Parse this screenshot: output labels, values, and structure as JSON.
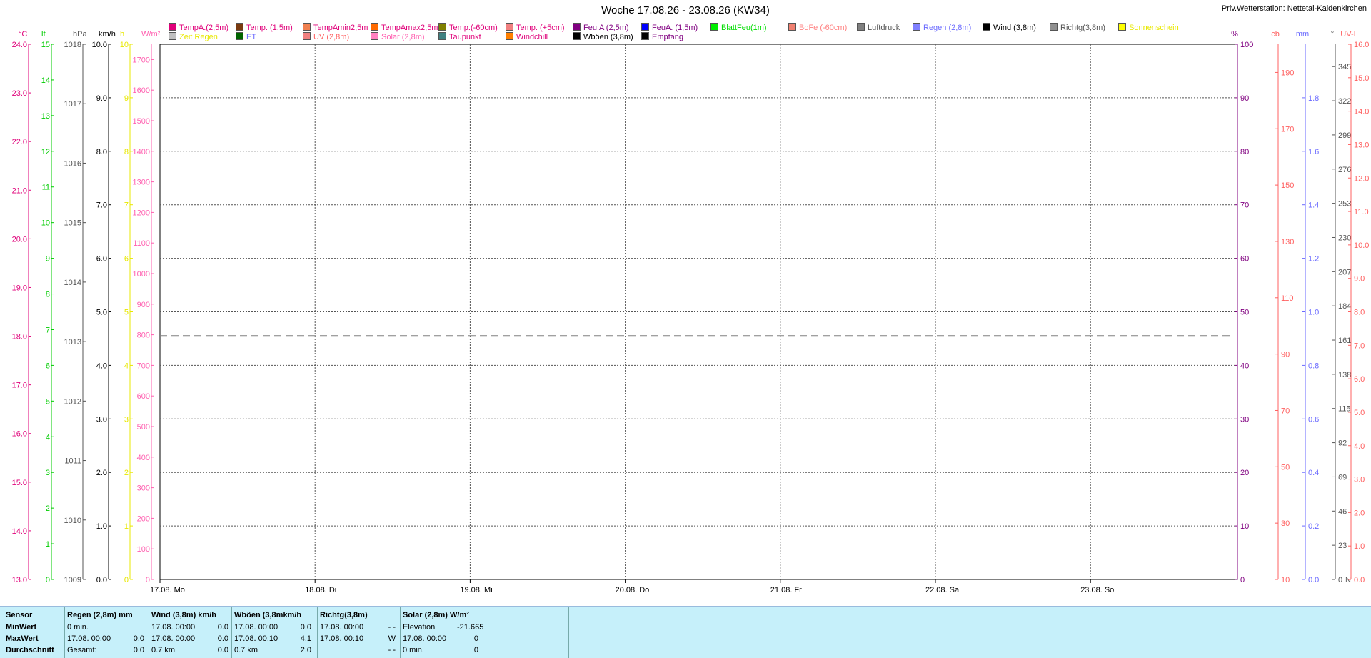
{
  "title": "Woche 17.08.26 - 23.08.26 (KW34)",
  "station": "Priv.Wetterstation: Nettetal-Kaldenkirchen",
  "legend": [
    {
      "label": "TempA.(2,5m)",
      "color": "#e0007a",
      "swatch": "#e0007a"
    },
    {
      "label": "Temp. (1,5m)",
      "color": "#e0007a",
      "swatch": "#7a3a10"
    },
    {
      "label": "TempAmin2,5m",
      "color": "#e0007a",
      "swatch": "#f08050"
    },
    {
      "label": "TempAmax2,5m",
      "color": "#e0007a",
      "swatch": "#ff6a00"
    },
    {
      "label": "Temp.(-60cm)",
      "color": "#e0007a",
      "swatch": "#808000"
    },
    {
      "label": "Temp. (+5cm)",
      "color": "#e0007a",
      "swatch": "#f08080"
    },
    {
      "label": "Feu.A (2,5m)",
      "color": "#800080",
      "swatch": "#800080"
    },
    {
      "label": "FeuA. (1,5m)",
      "color": "#800080",
      "swatch": "#0000ff"
    },
    {
      "label": "BlattFeu(1m)",
      "color": "#00dd00",
      "swatch": "#00ee00"
    },
    {
      "label": "BoFe (-60cm)",
      "color": "#ff8080",
      "swatch": "#f08070"
    },
    {
      "label": "Luftdruck",
      "color": "#555555",
      "swatch": "#808080"
    },
    {
      "label": "Regen (2,8m)",
      "color": "#6a6aff",
      "swatch": "#8080ff"
    },
    {
      "label": "Wind (3,8m)",
      "color": "#000000",
      "swatch": "#000000"
    },
    {
      "label": "Richtg(3,8m)",
      "color": "#555555",
      "swatch": "#909090"
    },
    {
      "label": "Sonnenschein",
      "color": "#e8e800",
      "swatch": "#ffff00"
    },
    {
      "label": "Zeit Regen",
      "color": "#e8e800",
      "swatch": "#c0c0c0"
    },
    {
      "label": "ET",
      "color": "#6a6aff",
      "swatch": "#006400"
    },
    {
      "label": "UV (2,8m)",
      "color": "#ff6060",
      "swatch": "#f08080"
    },
    {
      "label": "Solar (2,8m)",
      "color": "#ff60b0",
      "swatch": "#ff80c0"
    },
    {
      "label": "Taupunkt",
      "color": "#e0007a",
      "swatch": "#408080"
    },
    {
      "label": "Windchill",
      "color": "#e0007a",
      "swatch": "#ff8000"
    },
    {
      "label": "Wböen (3,8m)",
      "color": "#000000",
      "swatch": "#000000"
    },
    {
      "label": "Empfang",
      "color": "#800080",
      "swatch": "#000000"
    }
  ],
  "chart_data": {
    "type": "line",
    "x_categories": [
      "17.08.  Mo",
      "18.08.  Di",
      "19.08.  Mi",
      "20.08.  Do",
      "21.08.  Fr",
      "22.08.  Sa",
      "23.08.  So"
    ],
    "series": [
      {
        "name": "Luftdruck",
        "unit": "hPa",
        "values": [
          1013.1,
          1013.1,
          1013.1,
          1013.1,
          1013.1,
          1013.1,
          1013.1,
          1013.1
        ],
        "color": "#808080",
        "dash": true
      }
    ],
    "axes": {
      "left": [
        {
          "unit": "°C",
          "color": "#e0007a",
          "min": 13,
          "max": 24,
          "ticks": [
            "24.0",
            "23.0",
            "22.0",
            "21.0",
            "20.0",
            "19.0",
            "18.0",
            "17.0",
            "16.0",
            "15.0",
            "14.0",
            "13.0"
          ]
        },
        {
          "unit": "lf",
          "color": "#00cc00",
          "min": 0,
          "max": 15,
          "ticks": [
            "15",
            "14",
            "13",
            "12",
            "11",
            "10",
            "9",
            "8",
            "7",
            "6",
            "5",
            "4",
            "3",
            "2",
            "1",
            "0"
          ]
        },
        {
          "unit": "hPa",
          "color": "#555555",
          "min": 1009,
          "max": 1018,
          "ticks": [
            "1018",
            "1017",
            "1016",
            "1015",
            "1014",
            "1013",
            "1012",
            "1011",
            "1010",
            "1009"
          ]
        },
        {
          "unit": "km/h",
          "color": "#000000",
          "min": 0,
          "max": 10,
          "ticks": [
            "10.0",
            "9.0",
            "8.0",
            "7.0",
            "6.0",
            "5.0",
            "4.0",
            "3.0",
            "2.0",
            "1.0",
            "0.0"
          ]
        },
        {
          "unit": "h",
          "color": "#e8e800",
          "min": 0,
          "max": 10,
          "ticks": [
            "10",
            "9",
            "8",
            "7",
            "6",
            "5",
            "4",
            "3",
            "2",
            "1",
            "0"
          ]
        },
        {
          "unit": "W/m²",
          "color": "#ff60b0",
          "min": 0,
          "max": 1750,
          "ticks": [
            "1700",
            "1600",
            "1500",
            "1400",
            "1300",
            "1200",
            "1100",
            "1000",
            "900",
            "800",
            "700",
            "600",
            "500",
            "400",
            "300",
            "200",
            "100",
            "0"
          ]
        }
      ],
      "right": [
        {
          "unit": "%",
          "color": "#800080",
          "min": 0,
          "max": 100,
          "ticks": [
            "100",
            "90",
            "80",
            "70",
            "60",
            "50",
            "40",
            "30",
            "20",
            "10",
            "0"
          ]
        },
        {
          "unit": "cb",
          "color": "#ff6060",
          "min": 10,
          "max": 200,
          "ticks": [
            "190",
            "170",
            "150",
            "130",
            "110",
            "90",
            "70",
            "50",
            "30",
            "10"
          ]
        },
        {
          "unit": "mm",
          "color": "#6a6aff",
          "min": 0,
          "max": 2,
          "ticks": [
            "1.8",
            "1.6",
            "1.4",
            "1.2",
            "1.0",
            "0.8",
            "0.6",
            "0.4",
            "0.2",
            "0.0"
          ]
        },
        {
          "unit": "°",
          "color": "#555555",
          "min": 0,
          "max": 360,
          "ticks": [
            "345",
            "322",
            "299",
            "276",
            "253",
            "230",
            "207",
            "184",
            "161",
            "138",
            "115",
            "92",
            "69",
            "46",
            "23",
            "0"
          ],
          "bottom_label": "N"
        },
        {
          "unit": "UV-I",
          "color": "#ff6060",
          "min": 0,
          "max": 16,
          "ticks": [
            "16.0",
            "15.0",
            "14.0",
            "13.0",
            "12.0",
            "11.0",
            "10.0",
            "9.0",
            "8.0",
            "7.0",
            "6.0",
            "5.0",
            "4.0",
            "3.0",
            "2.0",
            "1.0",
            "0.0"
          ]
        }
      ]
    },
    "grid": true
  },
  "stats": {
    "row_labels": [
      "Sensor",
      "MinWert",
      "MaxWert",
      "Durchschnitt"
    ],
    "columns": [
      {
        "header": "Regen (2,8m)   mm",
        "rows": [
          [
            "0 min.",
            ""
          ],
          [
            "17.08.  00:00",
            "0.0"
          ],
          [
            "Gesamt:",
            "0.0"
          ]
        ]
      },
      {
        "header": "Wind (3,8m)   km/h",
        "rows": [
          [
            "17.08.  00:00",
            "0.0"
          ],
          [
            "17.08.  00:00",
            "0.0"
          ],
          [
            "0.7 km",
            "0.0"
          ]
        ]
      },
      {
        "header": "Wböen (3,8mkm/h",
        "rows": [
          [
            "17.08.  00:00",
            "0.0"
          ],
          [
            "17.08.  00:10",
            "4.1"
          ],
          [
            "0.7 km",
            "2.0"
          ]
        ]
      },
      {
        "header": "Richtg(3,8m)",
        "rows": [
          [
            "17.08.  00:00",
            "- -"
          ],
          [
            "17.08.  00:10",
            "W"
          ],
          [
            "",
            "- -"
          ]
        ]
      },
      {
        "header": "Solar (2,8m) W/m²",
        "rows": [
          [
            "Elevation",
            "-21.665"
          ],
          [
            "17.08.  00:00",
            "0"
          ],
          [
            "0 min.",
            "0"
          ]
        ]
      }
    ]
  }
}
